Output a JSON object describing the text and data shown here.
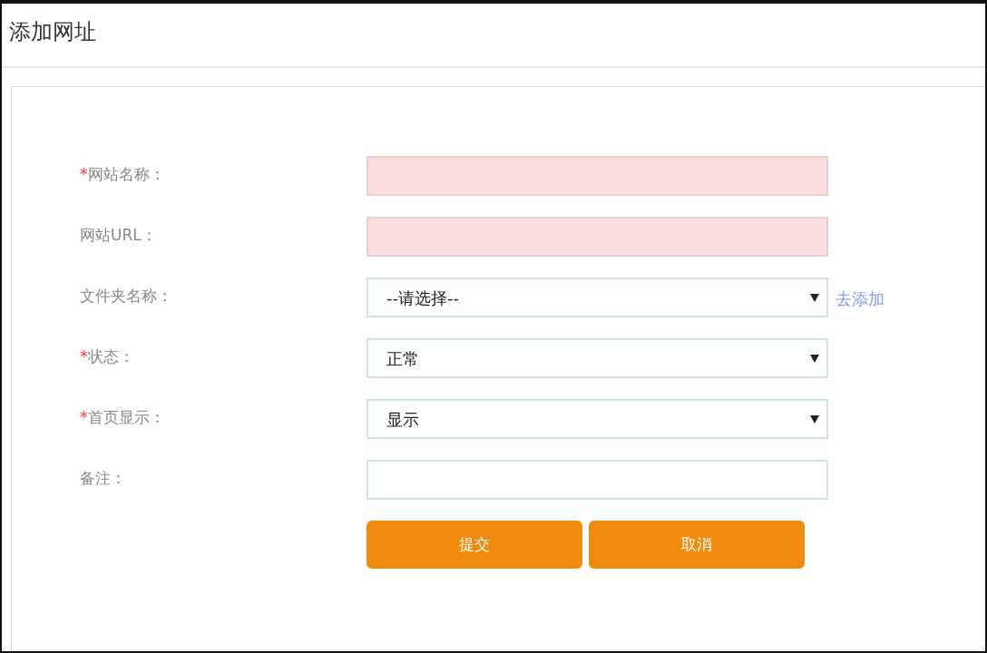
{
  "header": {
    "title": "添加网址"
  },
  "form": {
    "fields": [
      {
        "kind": "text",
        "required_mark": "*",
        "label": "网站名称：",
        "invalid": true
      },
      {
        "kind": "text",
        "label": "网站URL：",
        "invalid": true
      },
      {
        "kind": "select",
        "label": "文件夹名称：",
        "value": "--请选择--",
        "link": "去添加",
        "invalid": false
      },
      {
        "kind": "select",
        "required_mark": "*",
        "label": "状态：",
        "value": "正常",
        "invalid": false
      },
      {
        "kind": "select",
        "required_mark": "*",
        "label": "首页显示：",
        "value": "显示",
        "invalid": false
      },
      {
        "kind": "text",
        "label": "备注：",
        "invalid": false
      }
    ],
    "buttons": [
      "提交",
      "取消"
    ]
  }
}
